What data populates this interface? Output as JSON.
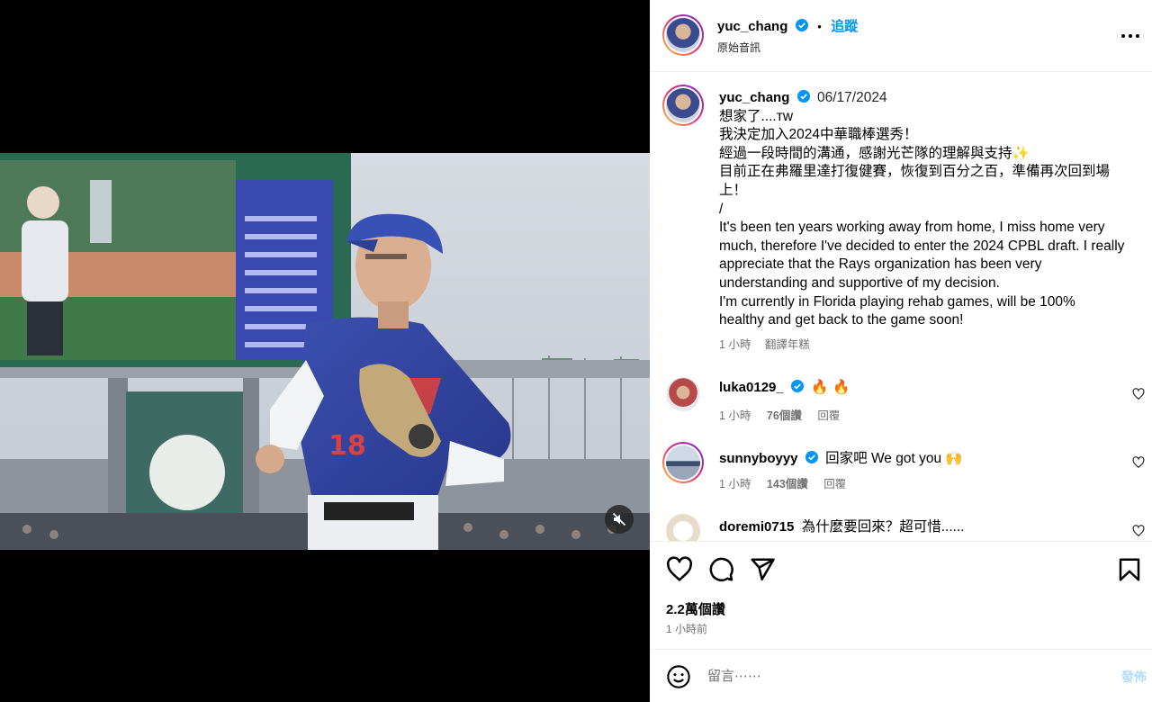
{
  "post": {
    "author": "yuc_chang",
    "follow_label": "追蹤",
    "dot": "•",
    "audio": "原始音訊",
    "date": "06/17/2024",
    "caption_lines": [
      "想家了....ᴛᴡ",
      "我決定加入2024中華職棒選秀！",
      "經過一段時間的溝通，感謝光芒隊的理解與支持✨",
      "目前正在弗羅里達打復健賽，恢復到百分之百，準備再次回到場",
      "上！",
      "/",
      "It's been ten years working away from home, I miss home very",
      "much, therefore I've decided to enter the 2024 CPBL draft. I really",
      "appreciate that the Rays organization has been very",
      "understanding and supportive of my decision.",
      "I'm currently in Florida playing rehab games, will be 100%",
      "healthy and get back to the game soon!"
    ],
    "caption_time": "1 小時",
    "translate_label": "翻譯年糕"
  },
  "comments": [
    {
      "user": "luka0129_",
      "verified": true,
      "text": "🔥 🔥",
      "time": "1 小時",
      "likes": "76個讚",
      "reply": "回覆"
    },
    {
      "user": "sunnyboyyy",
      "verified": true,
      "text": "回家吧 We got you 🙌",
      "time": "1 小時",
      "likes": "143個讚",
      "reply": "回覆"
    },
    {
      "user": "doremi0715",
      "verified": false,
      "text": "為什麼要回來？超可惜......",
      "time": "",
      "likes": "",
      "reply": ""
    }
  ],
  "actions": {
    "likes_count": "2.2萬個讚",
    "posted_time": "1 小時前"
  },
  "composer": {
    "placeholder": "留言⋯⋯",
    "post_label": "發佈"
  },
  "colors": {
    "verified": "#0095f6",
    "follow": "#0095f6",
    "post_disabled": "#b3dbff"
  }
}
